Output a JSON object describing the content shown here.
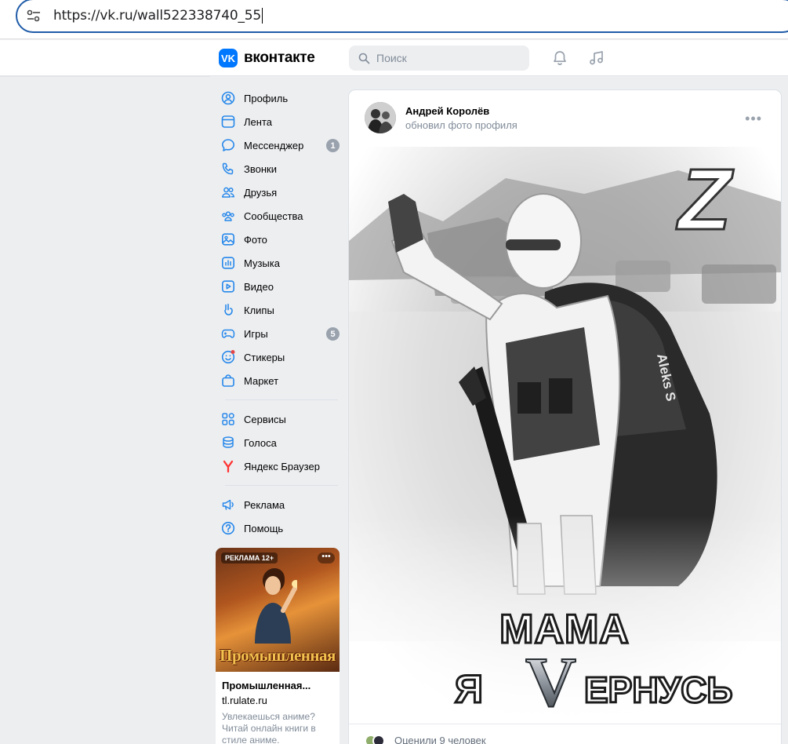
{
  "browser": {
    "url": "https://vk.ru/wall522338740_55"
  },
  "header": {
    "logo_mark": "VK",
    "logo_text": "вконтакте",
    "search_placeholder": "Поиск"
  },
  "nav": {
    "items": [
      {
        "label": "Профиль",
        "icon": "profile-icon"
      },
      {
        "label": "Лента",
        "icon": "feed-icon"
      },
      {
        "label": "Мессенджер",
        "icon": "messenger-icon",
        "badge": "1"
      },
      {
        "label": "Звонки",
        "icon": "phone-icon"
      },
      {
        "label": "Друзья",
        "icon": "friends-icon"
      },
      {
        "label": "Сообщества",
        "icon": "communities-icon"
      },
      {
        "label": "Фото",
        "icon": "photo-icon"
      },
      {
        "label": "Музыка",
        "icon": "music-icon"
      },
      {
        "label": "Видео",
        "icon": "video-icon"
      },
      {
        "label": "Клипы",
        "icon": "clips-icon"
      },
      {
        "label": "Игры",
        "icon": "games-icon",
        "badge": "5"
      },
      {
        "label": "Стикеры",
        "icon": "stickers-icon"
      },
      {
        "label": "Маркет",
        "icon": "market-icon"
      }
    ],
    "group2": [
      {
        "label": "Сервисы",
        "icon": "services-icon"
      },
      {
        "label": "Голоса",
        "icon": "coins-icon"
      },
      {
        "label": "Яндекс Браузер",
        "icon": "yandex-icon"
      }
    ],
    "group3": [
      {
        "label": "Реклама",
        "icon": "ads-icon"
      },
      {
        "label": "Помощь",
        "icon": "help-icon"
      }
    ]
  },
  "ad": {
    "tag": "РЕКЛАМА 12+",
    "more": "•••",
    "banner": "Промышленная революция",
    "title": "Промышленная...",
    "domain": "tl.rulate.ru",
    "description": "Увлекаешься аниме? Читай онлайн книги в стиле аниме."
  },
  "post": {
    "author": "Андрей Королёв",
    "action": "обновил фото профиля",
    "more": "•••",
    "photo": {
      "corner_letter": "Z",
      "patch_text": "Aleks S",
      "line1": "МАМА",
      "line2_prefix": "Я",
      "line2_v": "V",
      "line2_suffix": "ЕРНУСЬ"
    },
    "likes_text": "Оценили 9 человек"
  },
  "colors": {
    "accent": "#0077ff",
    "url_border": "#1f5ba8",
    "muted": "#818c99"
  }
}
